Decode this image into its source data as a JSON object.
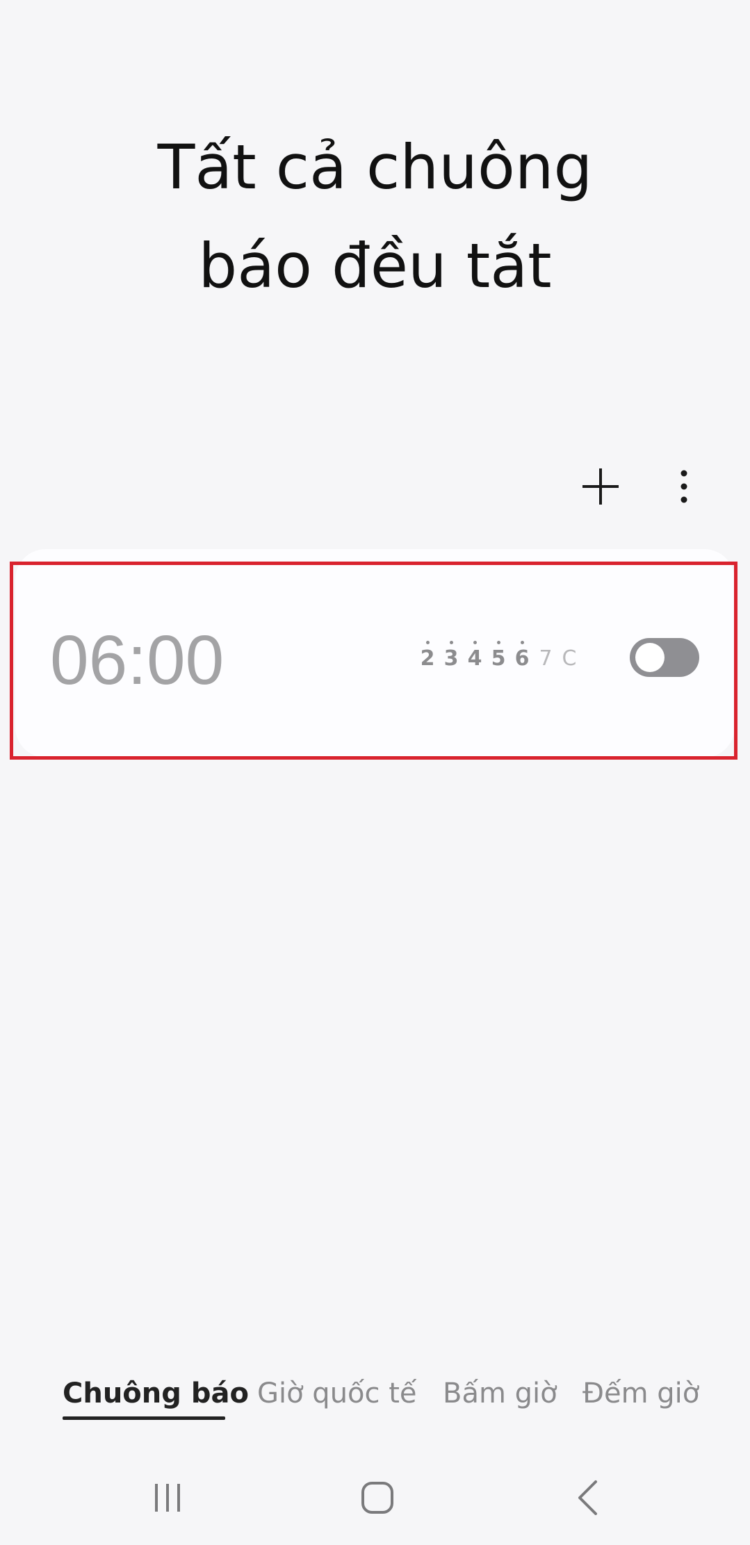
{
  "header": {
    "title_line1": "Tất cả chuông",
    "title_line2": "báo đều tắt"
  },
  "toolbar": {
    "add_icon": "plus-icon",
    "more_icon": "more-vertical-icon"
  },
  "alarm": {
    "time": "06:00",
    "enabled": false,
    "days": [
      {
        "label": "2",
        "active": true
      },
      {
        "label": "3",
        "active": true
      },
      {
        "label": "4",
        "active": true
      },
      {
        "label": "5",
        "active": true
      },
      {
        "label": "6",
        "active": true
      },
      {
        "label": "7",
        "active": false
      },
      {
        "label": "C",
        "active": false
      }
    ]
  },
  "tabs": [
    {
      "label": "Chuông báo",
      "active": true
    },
    {
      "label": "Giờ quốc tế",
      "active": false
    },
    {
      "label": "Bấm giờ",
      "active": false
    },
    {
      "label": "Đếm giờ",
      "active": false
    }
  ],
  "navbar": {
    "recents_icon": "recent-apps-icon",
    "home_icon": "home-icon",
    "back_icon": "back-icon"
  },
  "colors": {
    "background": "#f6f6f8",
    "card": "#fdfdff",
    "highlight": "#d9232e",
    "toggle_off": "#8f8f93"
  }
}
